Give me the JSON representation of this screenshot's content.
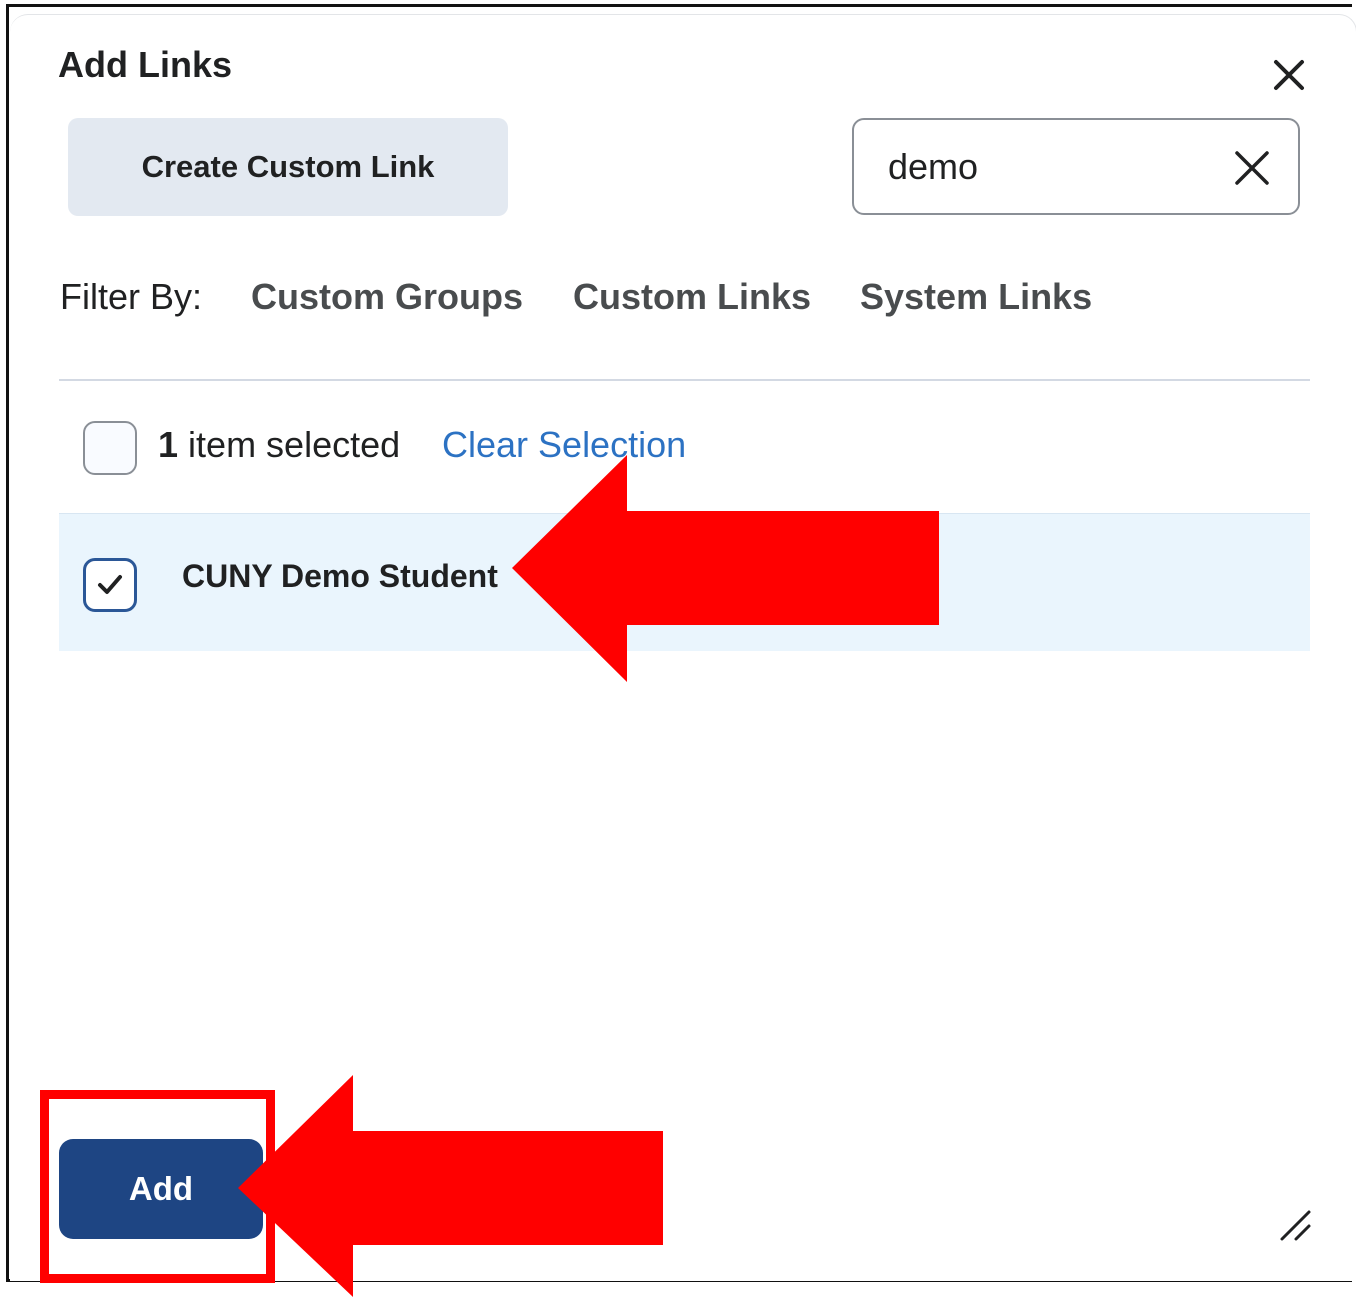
{
  "dialog": {
    "title": "Add Links",
    "close_icon": "close-icon"
  },
  "toolbar": {
    "create_custom_link_label": "Create Custom Link"
  },
  "search": {
    "value": "demo",
    "clear_icon": "clear-icon"
  },
  "filter": {
    "label": "Filter By:",
    "options": [
      {
        "label": "Custom Groups"
      },
      {
        "label": "Custom Links"
      },
      {
        "label": "System Links"
      }
    ]
  },
  "selection": {
    "count": "1",
    "count_suffix": "item selected",
    "clear_label": "Clear Selection",
    "select_all_checked": false
  },
  "results": [
    {
      "label": "CUNY Demo Student",
      "checked": true
    }
  ],
  "footer": {
    "add_label": "Add"
  },
  "colors": {
    "primary": "#1e4583",
    "link": "#2c72c3",
    "selected_row": "#eaf5fd",
    "annotation": "#ff0000"
  }
}
